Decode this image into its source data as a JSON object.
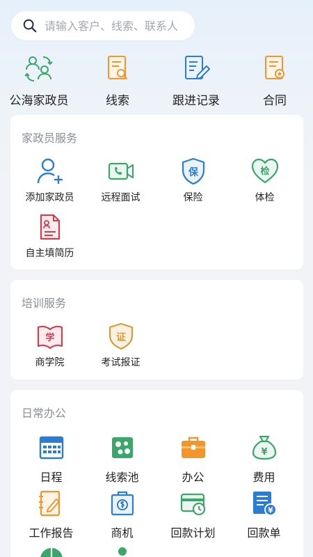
{
  "search": {
    "placeholder": "请输入客户、线索、联系人"
  },
  "quick_actions": [
    {
      "label": "公海家政员",
      "icon": "people-sync-icon"
    },
    {
      "label": "线索",
      "icon": "lead-search-icon"
    },
    {
      "label": "跟进记录",
      "icon": "follow-edit-icon"
    },
    {
      "label": "合同",
      "icon": "contract-icon"
    }
  ],
  "sections": {
    "housekeeper": {
      "title": "家政员服务",
      "items": [
        {
          "label": "添加家政员",
          "icon": "add-person-icon"
        },
        {
          "label": "远程面试",
          "icon": "video-call-icon"
        },
        {
          "label": "保险",
          "icon": "insurance-shield-icon",
          "glyph": "保"
        },
        {
          "label": "体检",
          "icon": "health-check-heart-icon",
          "glyph": "检"
        },
        {
          "label": "自主填简历",
          "icon": "resume-icon"
        }
      ]
    },
    "training": {
      "title": "培训服务",
      "items": [
        {
          "label": "商学院",
          "icon": "academy-book-icon",
          "glyph": "学"
        },
        {
          "label": "考试报证",
          "icon": "certificate-icon",
          "glyph": "证"
        }
      ]
    },
    "office": {
      "title": "日常办公",
      "items": [
        {
          "label": "日程",
          "icon": "calendar-icon"
        },
        {
          "label": "线索池",
          "icon": "lead-pool-icon"
        },
        {
          "label": "办公",
          "icon": "briefcase-icon"
        },
        {
          "label": "费用",
          "icon": "money-bag-icon",
          "glyph": "¥"
        },
        {
          "label": "工作报告",
          "icon": "work-report-icon"
        },
        {
          "label": "商机",
          "icon": "opportunity-icon"
        },
        {
          "label": "回款计划",
          "icon": "payment-plan-icon"
        },
        {
          "label": "回款单",
          "icon": "payment-receipt-icon",
          "glyph": "¥"
        }
      ]
    }
  },
  "colors": {
    "green": "#3aa66a",
    "orange": "#f0962d",
    "blue": "#2b7cd3",
    "red": "#c8434f",
    "gold": "#d99b3a"
  }
}
